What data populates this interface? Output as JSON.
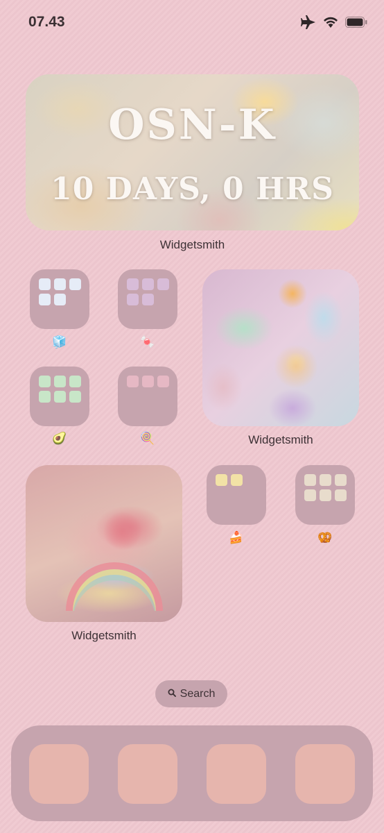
{
  "status": {
    "time": "07.43"
  },
  "banner": {
    "title": "OSN-K",
    "subtitle": "10 DAYS, 0 HRS",
    "label": "Widgetsmith"
  },
  "photo_widgets": [
    {
      "label": "Widgetsmith"
    },
    {
      "label": "Widgetsmith"
    }
  ],
  "folders": [
    {
      "emoji": "🧊",
      "cells": [
        "#e6ecf7",
        "#e6ecf7",
        "#e6ecf7",
        "#e6ecf7",
        "#e6ecf7"
      ]
    },
    {
      "emoji": "🍬",
      "cells": [
        "#d8bcd8",
        "#d8bcd8",
        "#d8bcd8",
        "#d8bcd8",
        "#d8bcd8"
      ]
    },
    {
      "emoji": "🥑",
      "cells": [
        "#c8e6c8",
        "#c8e6c8",
        "#c8e6c8",
        "#c8e6c8",
        "#c8e6c8",
        "#c8e6c8"
      ]
    },
    {
      "emoji": "🍭",
      "cells": [
        "#e6b8c4",
        "#e6b8c4",
        "#e6b8c4"
      ]
    },
    {
      "emoji": "🍰",
      "cells": [
        "#f2e2a6",
        "#f2e2a6"
      ]
    },
    {
      "emoji": "🥨",
      "cells": [
        "#e8dccc",
        "#e8dccc",
        "#e8dccc",
        "#e8dccc",
        "#e8dccc",
        "#e8dccc"
      ]
    }
  ],
  "search": {
    "label": "Search"
  },
  "colors": {
    "background": "#f0cbd2",
    "folder": "#c6a4ae",
    "dock_app": "#e6b5ad"
  }
}
